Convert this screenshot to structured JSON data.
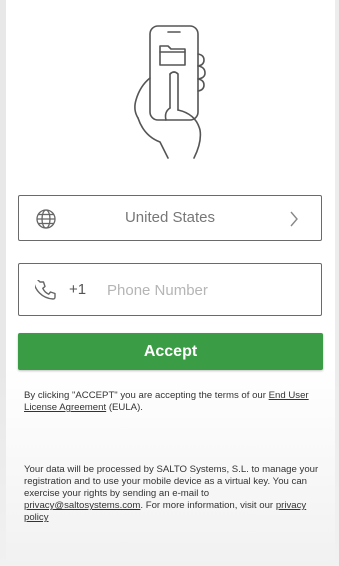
{
  "country": {
    "name": "United States",
    "globe_icon": "globe-icon",
    "chevron_icon": "chevron-right-icon"
  },
  "phone": {
    "dial_code": "+1",
    "placeholder": "Phone Number",
    "value": "",
    "icon": "phone-icon"
  },
  "accept_button": {
    "label": "Accept"
  },
  "terms": {
    "text_before": "By clicking \"ACCEPT\" you are accepting the terms of our",
    "link_label": "End User License Agreement",
    "text_after": "(EULA)."
  },
  "privacy": {
    "text_before": "Your data will be processed by SALTO Systems, S.L. to manage your registration and to use your mobile device as a virtual key. You can exercise your rights by sending an e-mail to",
    "email_link": "privacy@saltosystems.com",
    "text_middle": ". For more information, visit our",
    "policy_link": "privacy policy"
  },
  "colors": {
    "accent_green": "#3a9c44",
    "field_border": "#6a6a6a"
  }
}
